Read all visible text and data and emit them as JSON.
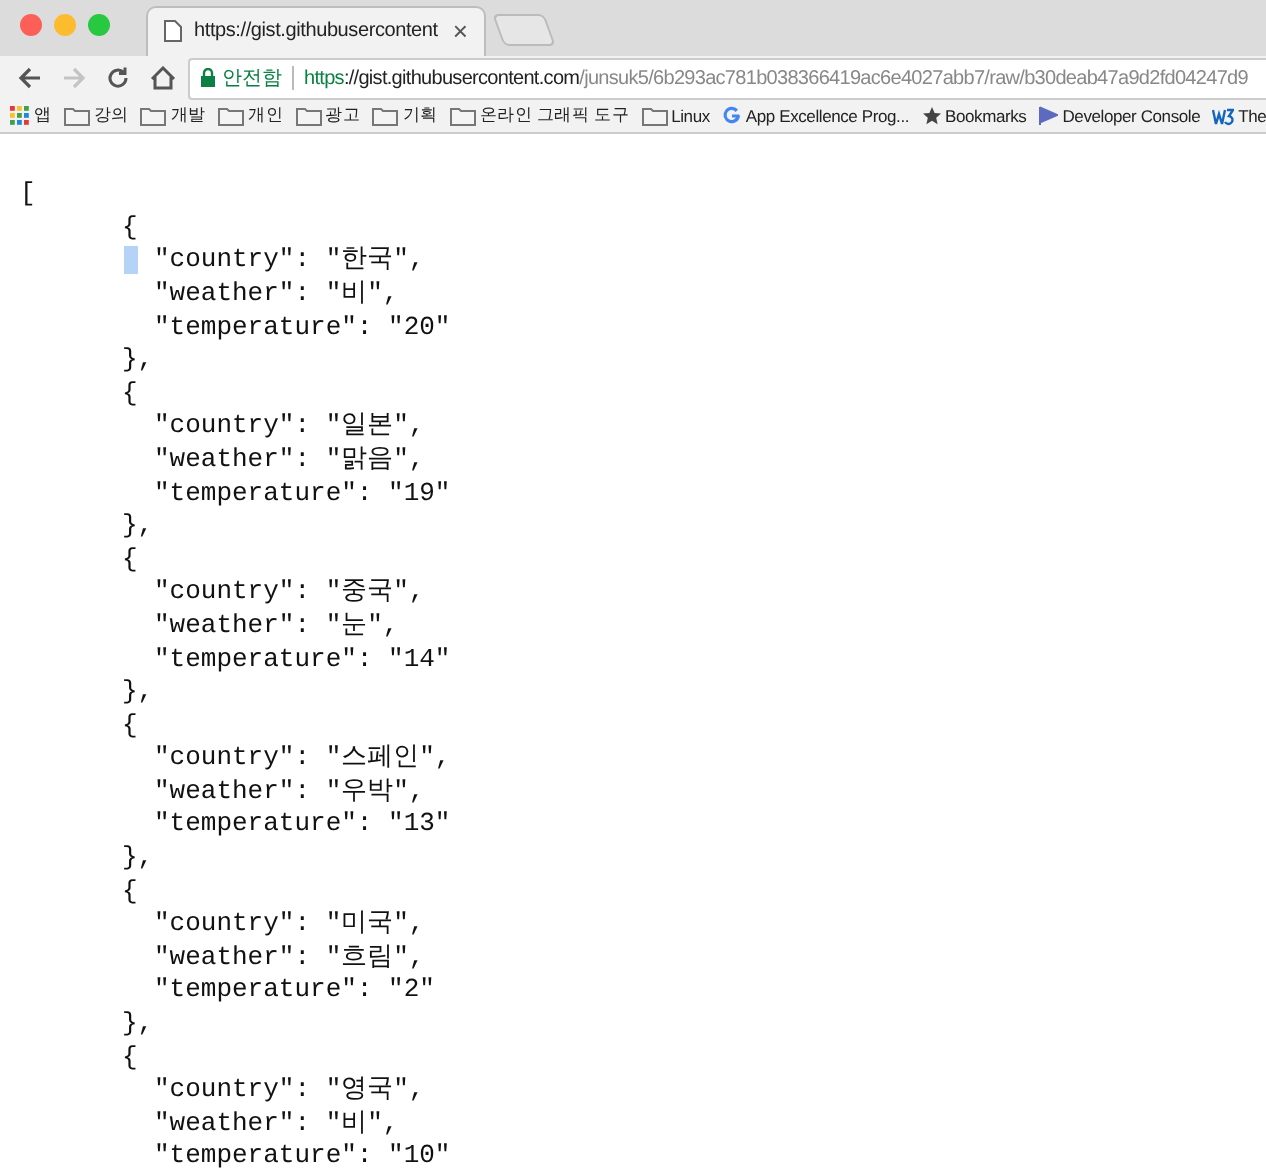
{
  "tab": {
    "title": "https://gist.githubusercontent",
    "close": "×"
  },
  "toolbar": {
    "back_disabled": false,
    "forward_disabled": true,
    "security": "안전함",
    "url": {
      "scheme": "https",
      "host": "://gist.githubusercontent.com",
      "path": "/junsuk5/6b293ac781b038366419ac6e4027abb7/raw/b30deab47a9d2fd04247d9"
    }
  },
  "bookmarks": [
    {
      "kind": "apps",
      "label": "앱"
    },
    {
      "kind": "folder",
      "label": "강의"
    },
    {
      "kind": "folder",
      "label": "개발"
    },
    {
      "kind": "folder",
      "label": "개인"
    },
    {
      "kind": "folder",
      "label": "광고"
    },
    {
      "kind": "folder",
      "label": "기획"
    },
    {
      "kind": "folder",
      "label": "온라인 그래픽 도구"
    },
    {
      "kind": "folder",
      "label": "Linux"
    },
    {
      "kind": "google",
      "label": "App Excellence Prog..."
    },
    {
      "kind": "star",
      "label": "Bookmarks"
    },
    {
      "kind": "flag",
      "label": "Developer Console"
    },
    {
      "kind": "w3",
      "label": "The"
    }
  ],
  "lines": [
    {
      "kind": "bracket",
      "text": "[",
      "selected": false
    },
    {
      "kind": "brace",
      "text": "{",
      "selected": false
    },
    {
      "kind": "field",
      "text": "\"country\": \"한국\",",
      "selected": true
    },
    {
      "kind": "field",
      "text": "\"weather\": \"비\",",
      "selected": false
    },
    {
      "kind": "field",
      "text": "\"temperature\": \"20\"",
      "selected": false
    },
    {
      "kind": "brace",
      "text": "},",
      "selected": false
    },
    {
      "kind": "brace",
      "text": "{",
      "selected": false
    },
    {
      "kind": "field",
      "text": "\"country\": \"일본\",",
      "selected": false
    },
    {
      "kind": "field",
      "text": "\"weather\": \"맑음\",",
      "selected": false
    },
    {
      "kind": "field",
      "text": "\"temperature\": \"19\"",
      "selected": false
    },
    {
      "kind": "brace",
      "text": "},",
      "selected": false
    },
    {
      "kind": "brace",
      "text": "{",
      "selected": false
    },
    {
      "kind": "field",
      "text": "\"country\": \"중국\",",
      "selected": false
    },
    {
      "kind": "field",
      "text": "\"weather\": \"눈\",",
      "selected": false
    },
    {
      "kind": "field",
      "text": "\"temperature\": \"14\"",
      "selected": false
    },
    {
      "kind": "brace",
      "text": "},",
      "selected": false
    },
    {
      "kind": "brace",
      "text": "{",
      "selected": false
    },
    {
      "kind": "field",
      "text": "\"country\": \"스페인\",",
      "selected": false
    },
    {
      "kind": "field",
      "text": "\"weather\": \"우박\",",
      "selected": false
    },
    {
      "kind": "field",
      "text": "\"temperature\": \"13\"",
      "selected": false
    },
    {
      "kind": "brace",
      "text": "},",
      "selected": false
    },
    {
      "kind": "brace",
      "text": "{",
      "selected": false
    },
    {
      "kind": "field",
      "text": "\"country\": \"미국\",",
      "selected": false
    },
    {
      "kind": "field",
      "text": "\"weather\": \"흐림\",",
      "selected": false
    },
    {
      "kind": "field",
      "text": "\"temperature\": \"2\"",
      "selected": false
    },
    {
      "kind": "brace",
      "text": "},",
      "selected": false
    },
    {
      "kind": "brace",
      "text": "{",
      "selected": false
    },
    {
      "kind": "field",
      "text": "\"country\": \"영국\",",
      "selected": false
    },
    {
      "kind": "field",
      "text": "\"weather\": \"비\",",
      "selected": false
    },
    {
      "kind": "field",
      "text": "\"temperature\": \"10\"",
      "selected": false
    }
  ]
}
